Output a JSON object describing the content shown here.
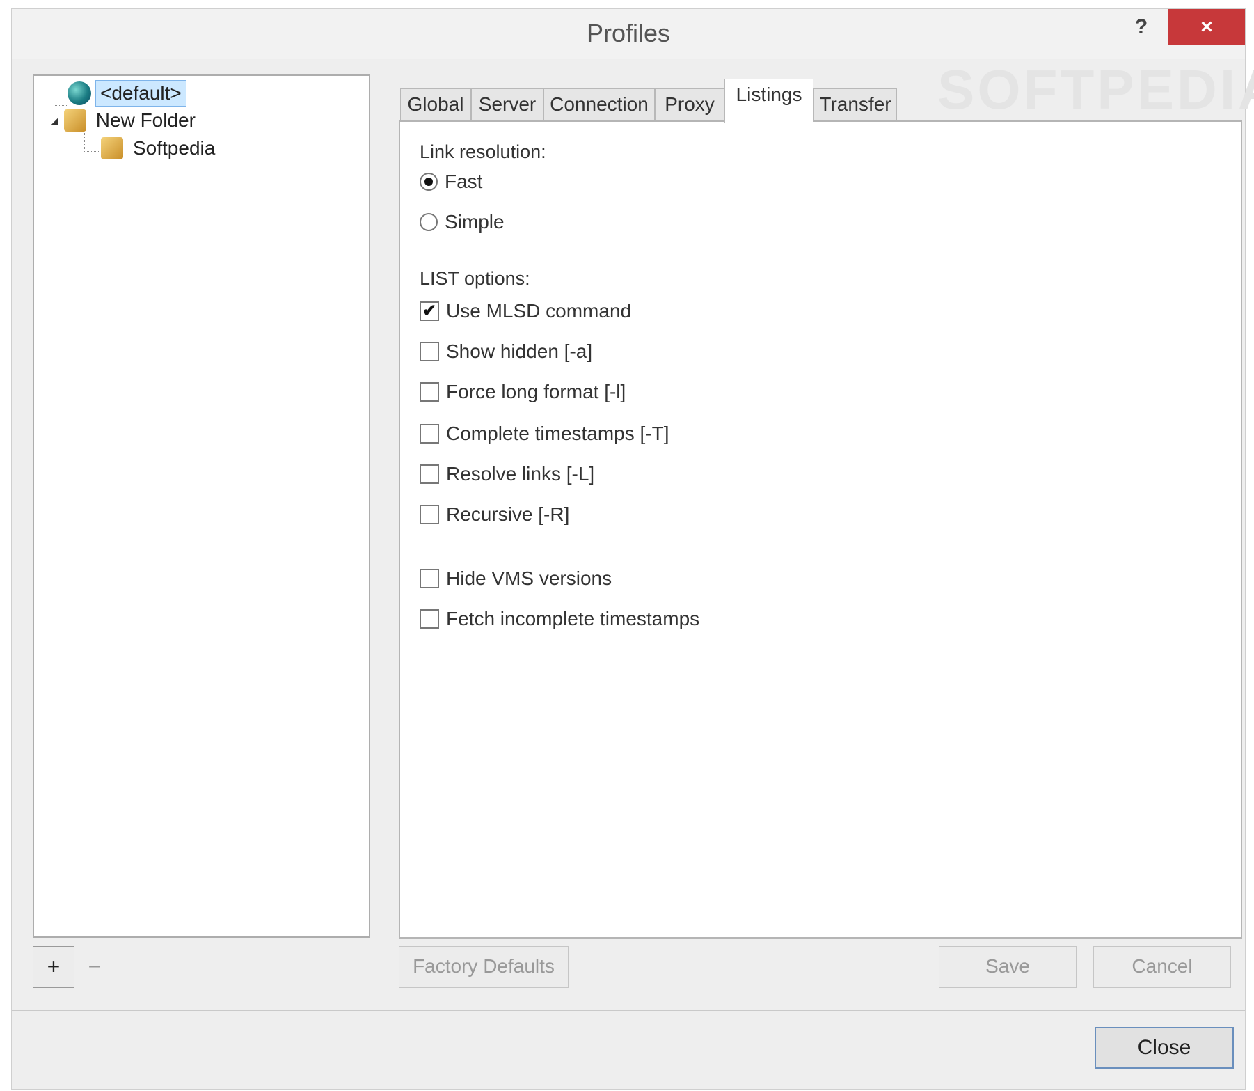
{
  "window": {
    "title": "Profiles",
    "help": "?",
    "close": "×",
    "watermark": "SOFTPEDIA"
  },
  "tree": {
    "items": [
      {
        "label": "<default>",
        "icon": "globe-icon",
        "selected": true
      },
      {
        "label": "New Folder",
        "icon": "folder-box-icon",
        "expander": "◢"
      },
      {
        "label": "Softpedia",
        "icon": "folder-box-icon"
      }
    ]
  },
  "tabs": [
    {
      "label": "Global"
    },
    {
      "label": "Server"
    },
    {
      "label": "Connection"
    },
    {
      "label": "Proxy"
    },
    {
      "label": "Listings",
      "active": true
    },
    {
      "label": "Transfer"
    }
  ],
  "listings": {
    "link_resolution_label": "Link resolution:",
    "radios": [
      {
        "label": "Fast",
        "checked": true
      },
      {
        "label": "Simple",
        "checked": false
      }
    ],
    "list_options_label": "LIST options:",
    "checks": [
      {
        "label": "Use MLSD command",
        "checked": true
      },
      {
        "label": "Show hidden [-a]",
        "checked": false
      },
      {
        "label": "Force long format [-l]",
        "checked": false
      },
      {
        "label": "Complete timestamps [-T]",
        "checked": false
      },
      {
        "label": "Resolve links [-L]",
        "checked": false
      },
      {
        "label": "Recursive [-R]",
        "checked": false
      }
    ],
    "extra_checks": [
      {
        "label": "Hide VMS versions",
        "checked": false
      },
      {
        "label": "Fetch incomplete timestamps",
        "checked": false
      }
    ]
  },
  "buttons": {
    "add": "+",
    "remove": "−",
    "factory_defaults": "Factory Defaults",
    "save": "Save",
    "cancel": "Cancel",
    "close": "Close"
  }
}
